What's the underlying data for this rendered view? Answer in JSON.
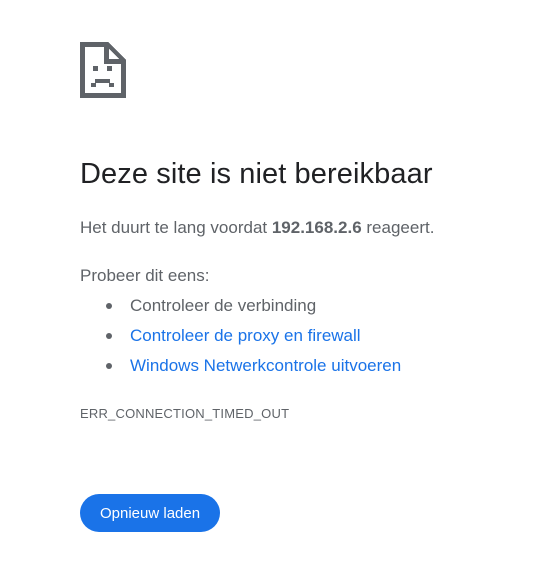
{
  "icon": "sad-page-icon",
  "heading": "Deze site is niet bereikbaar",
  "description": {
    "prefix": "Het duurt te lang voordat ",
    "host": "192.168.2.6",
    "suffix": " reageert."
  },
  "suggestions": {
    "intro": "Probeer dit eens:",
    "items": [
      {
        "label": "Controleer de verbinding",
        "is_link": false
      },
      {
        "label": "Controleer de proxy en firewall",
        "is_link": true
      },
      {
        "label": "Windows Netwerkcontrole uitvoeren",
        "is_link": true
      }
    ]
  },
  "error_code": "ERR_CONNECTION_TIMED_OUT",
  "reload_button": "Opnieuw laden",
  "colors": {
    "accent": "#1a73e8",
    "text": "#5f6368",
    "heading": "#202124"
  }
}
